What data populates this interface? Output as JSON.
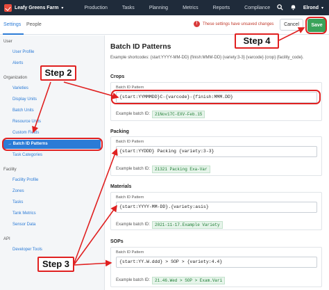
{
  "topbar": {
    "farm_name": "Leafy Greens Farm",
    "nav": [
      "Production",
      "Tasks",
      "Planning",
      "Metrics",
      "Reports",
      "Compliance"
    ],
    "user_name": "Elrond"
  },
  "tabs": [
    "Settings",
    "People"
  ],
  "warning_text": "These settings have unsaved changes",
  "buttons": {
    "cancel": "Cancel",
    "save": "Save"
  },
  "sidebar": {
    "user_header": "User",
    "user_items": [
      "User Profile",
      "Alerts"
    ],
    "org_header": "Organization",
    "org_items": [
      "Varieties",
      "Display Units",
      "Batch Units",
      "Resource Units",
      "Custom Fields",
      "Batch ID Patterns",
      "Task Categories"
    ],
    "facility_header": "Facility",
    "facility_items": [
      "Facility Profile",
      "Zones",
      "Tasks",
      "Tank Metrics",
      "Sensor Data"
    ],
    "api_header": "API",
    "api_items": [
      "Developer Tools"
    ]
  },
  "main": {
    "title": "Batch ID Patterns",
    "shortcodes": "Example shortcodes: {start:YYYY-MM-DD} {finish:MMM-DD} {variety:3-3} {varcode} {crop} {facility_code}.",
    "field_label": "Batch ID Pattern",
    "example_label": "Example batch ID:",
    "sections": [
      {
        "name": "Crops",
        "pattern": "{start:YYMMMDD}C-{varcode}-{finish:MMM.DD}",
        "example": "21Nov17C-EXV-Feb.15"
      },
      {
        "name": "Packing",
        "pattern": "{start:YYDDD} Packing {variety:3-3}",
        "example": "21321 Packing Exa-Var"
      },
      {
        "name": "Materials",
        "pattern": "{start:YYYY-MM-DD}.{variety:asis}",
        "example": "2021-11-17.Example Variety"
      },
      {
        "name": "SOPs",
        "pattern": "{start:YY.W.ddd} > SOP > {variety:4.4}",
        "example": "21.46.Wed > SOP > Exam.Vari"
      }
    ]
  },
  "annotations": {
    "step2": "Step 2",
    "step3": "Step 3",
    "step4": "Step 4"
  },
  "colors": {
    "nav_bg": "#1f2b3a",
    "accent": "#2b7bd6",
    "save": "#3aa35a",
    "annotation": "#e02020",
    "example_bg": "#e6f4ea"
  },
  "icons": [
    "checkmark-logo-icon",
    "search-icon",
    "bell-icon",
    "chevron-down-icon",
    "warning-icon",
    "arrow-right-icon"
  ]
}
